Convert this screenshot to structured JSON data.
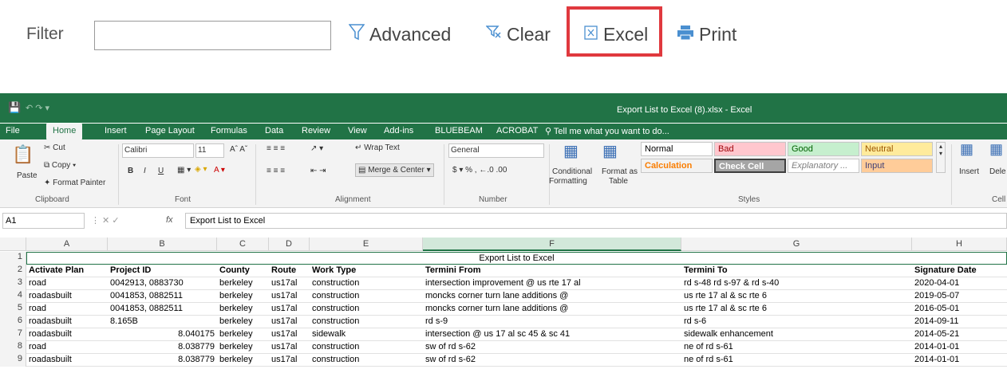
{
  "filter": {
    "label": "Filter",
    "input_value": "",
    "advanced_label": "Advanced",
    "clear_label": "Clear",
    "excel_label": "Excel",
    "print_label": "Print"
  },
  "excel": {
    "window_title": "Export List to Excel (8).xlsx - Excel",
    "tabs": [
      "File",
      "Home",
      "Insert",
      "Page Layout",
      "Formulas",
      "Data",
      "Review",
      "View",
      "Add-ins",
      "BLUEBEAM",
      "ACROBAT"
    ],
    "tell_me": "Tell me what you want to do...",
    "ribbon": {
      "cut": "Cut",
      "copy": "Copy",
      "paste": "Paste",
      "format_painter": "Format Painter",
      "clipboard": "Clipboard",
      "font_name": "Calibri",
      "font_size": "11",
      "font": "Font",
      "wrap_text": "Wrap Text",
      "merge_center": "Merge & Center",
      "alignment": "Alignment",
      "number_format": "General",
      "number": "Number",
      "conditional": "Conditional",
      "formatting": "Formatting",
      "format_as": "Format as",
      "table": "Table",
      "styles_label": "Styles",
      "styles": {
        "normal": "Normal",
        "bad": "Bad",
        "good": "Good",
        "neutral": "Neutral",
        "calculation": "Calculation",
        "check_cell": "Check Cell",
        "explanatory": "Explanatory ...",
        "input": "Input"
      },
      "insert": "Insert",
      "delete": "Dele",
      "cells": "Cell"
    },
    "name_box": "A1",
    "formula": "Export List to Excel",
    "columns": [
      "A",
      "B",
      "C",
      "D",
      "E",
      "F",
      "G",
      "H"
    ],
    "merged_title": "Export List to Excel",
    "rows": [
      {
        "n": "1"
      },
      {
        "n": "2",
        "cells": [
          "Activate Plan",
          "Project ID",
          "County",
          "Route",
          "Work Type",
          "Termini From",
          "Termini To",
          "Signature Date"
        ]
      },
      {
        "n": "3",
        "cells": [
          "road",
          "0042913, 0883730",
          "berkeley",
          "us17al",
          "construction",
          "intersection improvement @ us rte 17 al",
          "rd s-48 rd s-97 & rd s-40",
          "2020-04-01"
        ]
      },
      {
        "n": "4",
        "cells": [
          "roadasbuilt",
          "0041853, 0882511",
          "berkeley",
          "us17al",
          "construction",
          "moncks corner turn lane additions @",
          "us rte 17 al & sc rte 6",
          "2019-05-07"
        ]
      },
      {
        "n": "5",
        "cells": [
          "road",
          "0041853, 0882511",
          "berkeley",
          "us17al",
          "construction",
          "moncks corner turn lane additions @",
          "us rte 17 al & sc rte 6",
          "2016-05-01"
        ]
      },
      {
        "n": "6",
        "cells": [
          "roadasbuilt",
          "8.165B",
          "berkeley",
          "us17al",
          "construction",
          "rd s-9",
          "rd s-6",
          "2014-09-11"
        ]
      },
      {
        "n": "7",
        "cells": [
          "roadasbuilt",
          "8.040175",
          "berkeley",
          "us17al",
          "sidewalk",
          "intersection @ us 17 al sc 45 & sc 41",
          "sidewalk enhancement",
          "2014-05-21"
        ]
      },
      {
        "n": "8",
        "cells": [
          "road",
          "8.038779",
          "berkeley",
          "us17al",
          "construction",
          "sw of rd s-62",
          "ne of rd s-61",
          "2014-01-01"
        ]
      },
      {
        "n": "9",
        "cells": [
          "roadasbuilt",
          "8.038779",
          "berkeley",
          "us17al",
          "construction",
          "sw of rd s-62",
          "ne of rd s-61",
          "2014-01-01"
        ]
      }
    ],
    "colors": {
      "accent": "#217346",
      "highlight": "#e0393e"
    }
  }
}
